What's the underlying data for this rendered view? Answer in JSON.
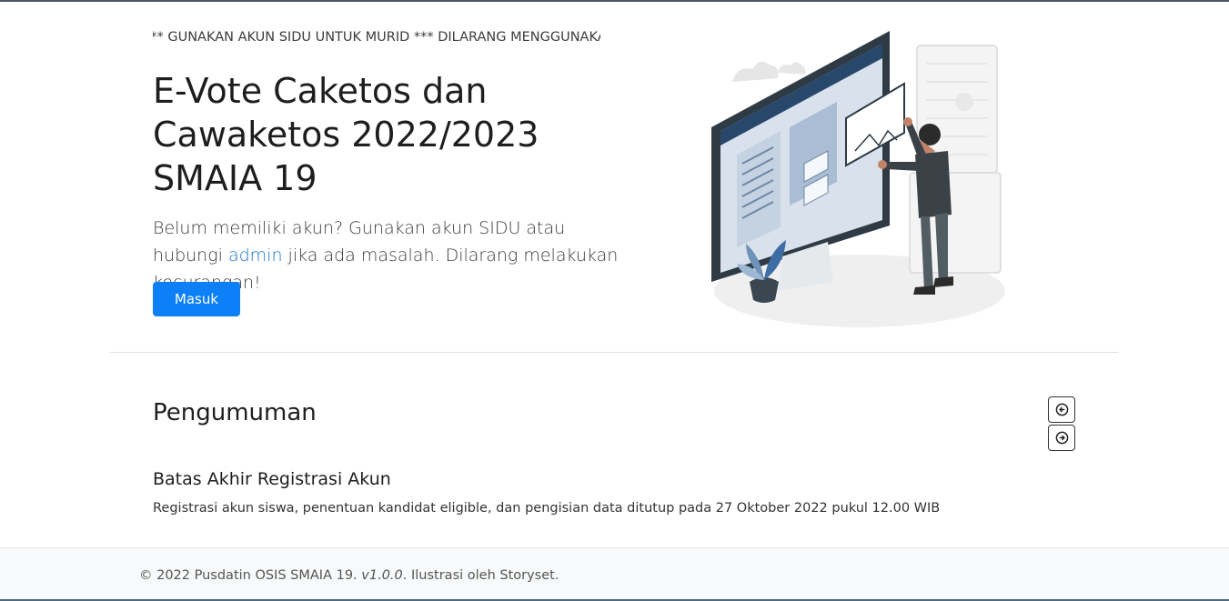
{
  "marquee": {
    "text": "*** GUNAKAN AKUN SIDU UNTUK MURID *** DILARANG MENGGUNAKAN AKUN ORANG LAIN ***"
  },
  "hero": {
    "title": "E-Vote Caketos dan Cawaketos 2022/2023 SMAIA 19",
    "text_before": "Belum memiliki akun? Gunakan akun SIDU atau hubungi ",
    "admin_link": "admin",
    "text_after": " jika ada masalah. Dilarang melakukan kecurangan!",
    "login_button": "Masuk"
  },
  "announcements": {
    "heading": "Pengumuman",
    "prev_icon": "arrow-left-circle-icon",
    "next_icon": "arrow-right-circle-icon",
    "current": {
      "title": "Batas Akhir Registrasi Akun",
      "body": "Registrasi akun siswa, penentuan kandidat eligible, dan pengisian data ditutup pada 27 Oktober 2022 pukul 12.00 WIB"
    }
  },
  "footer": {
    "copyright": "© 2022 Pusdatin OSIS SMAIA 19. ",
    "version": "v1.0.0",
    "credit": ". Ilustrasi oleh Storyset."
  },
  "colors": {
    "primary": "#0d7ff7",
    "link": "#1a73c8",
    "footer_bg": "#f8f9fa"
  }
}
